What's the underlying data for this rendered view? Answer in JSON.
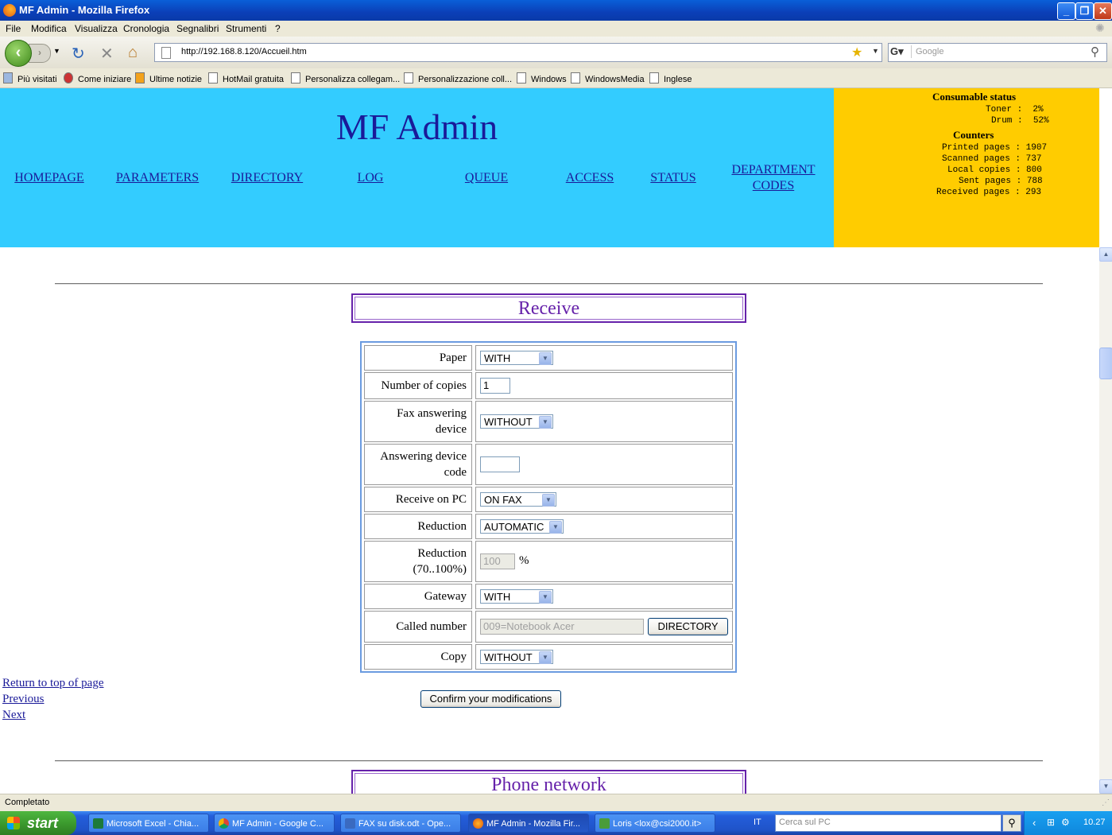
{
  "window": {
    "title": "MF Admin - Mozilla Firefox"
  },
  "menu": [
    "File",
    "Modifica",
    "Visualizza",
    "Cronologia",
    "Segnalibri",
    "Strumenti",
    "?"
  ],
  "url": "http://192.168.8.120/Accueil.htm",
  "search_placeholder": "Google",
  "bookmarks": [
    "Più visitati",
    "Come iniziare",
    "Ultime notizie",
    "HotMail gratuita",
    "Personalizza collegam...",
    "Personalizzazione coll...",
    "Windows",
    "WindowsMedia",
    "Inglese"
  ],
  "page": {
    "title": "MF Admin",
    "nav": [
      "HOMEPAGE",
      "PARAMETERS",
      "DIRECTORY",
      "LOG",
      "QUEUE",
      "ACCESS",
      "STATUS",
      "DEPARTMENT",
      "CODES"
    ],
    "consumables": {
      "heading": "Consumable status",
      "toner_label": "Toner",
      "toner_value": "2%",
      "drum_label": "Drum",
      "drum_value": "52%"
    },
    "counters": {
      "heading": "Counters",
      "rows": [
        {
          "label": "Printed pages",
          "value": "1907"
        },
        {
          "label": "Scanned pages",
          "value": "737"
        },
        {
          "label": "Local copies",
          "value": "800"
        },
        {
          "label": "Sent pages",
          "value": "788"
        },
        {
          "label": "Received pages",
          "value": "293"
        }
      ]
    },
    "section_receive": "Receive",
    "form": {
      "paper_label": "Paper",
      "paper_value": "WITH",
      "copies_label": "Number of copies",
      "copies_value": "1",
      "fax_answering_label_1": "Fax answering",
      "fax_answering_label_2": "device",
      "fax_answering_value": "WITHOUT",
      "answer_code_label_1": "Answering device",
      "answer_code_label_2": "code",
      "answer_code_value": "",
      "receive_pc_label": "Receive on PC",
      "receive_pc_value": "ON FAX",
      "reduction_label": "Reduction",
      "reduction_value": "AUTOMATIC",
      "reduction_pct_label_1": "Reduction",
      "reduction_pct_label_2": "(70..100%)",
      "reduction_pct_value": "100",
      "reduction_pct_unit": "%",
      "gateway_label": "Gateway",
      "gateway_value": "WITH",
      "called_label": "Called number",
      "called_value": "009=Notebook Acer",
      "directory_button": "DIRECTORY",
      "copy_label": "Copy",
      "copy_value": "WITHOUT"
    },
    "confirm_button": "Confirm your modifications",
    "links": {
      "top": "Return to top of page",
      "previous": "Previous",
      "next": "Next"
    },
    "section_phone": "Phone network"
  },
  "statusbar": "Completato",
  "taskbar": {
    "start": "start",
    "tasks": [
      "Microsoft Excel - Chia...",
      "MF Admin - Google C...",
      "FAX su disk.odt - Ope...",
      "MF Admin - Mozilla Fir...",
      "Loris <lox@csi2000.it>"
    ],
    "lang": "IT",
    "search_placeholder": "Cerca sul PC",
    "clock": "10.27"
  }
}
